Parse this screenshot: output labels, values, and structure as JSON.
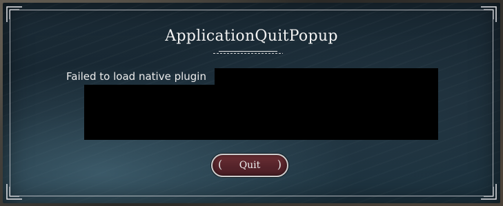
{
  "popup": {
    "title": "ApplicationQuitPopup",
    "message": "Failed to load native plugin",
    "quit_label": "Quit"
  },
  "icons": {
    "corners": "corner-ornament-icon",
    "button_brackets": "bracket-icon"
  },
  "colors": {
    "panel_background": "#162631",
    "border": "#e1e1e6",
    "button_fill": "#55232a",
    "redaction": "#000000"
  }
}
